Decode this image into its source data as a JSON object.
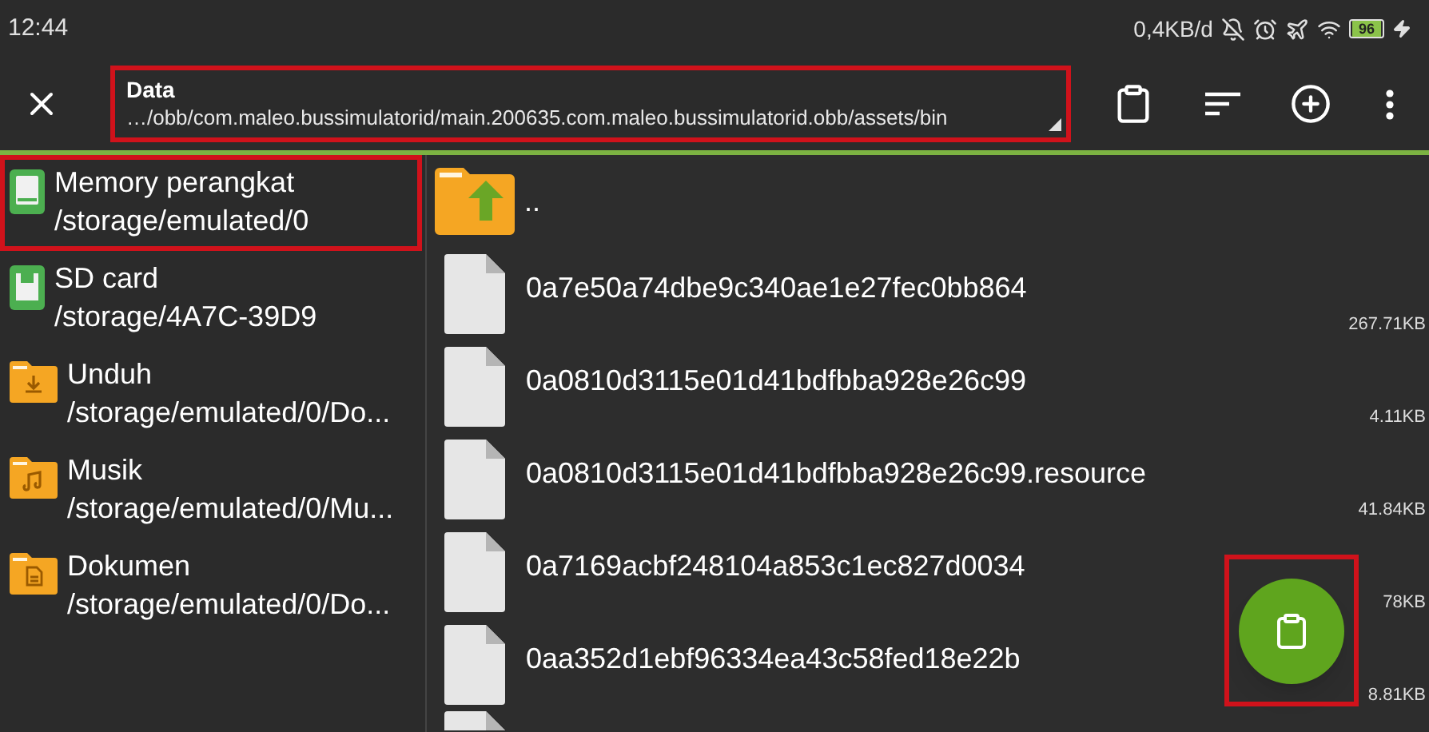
{
  "status_bar": {
    "time": "12:44",
    "speed": "0,4KB/d",
    "battery": "96"
  },
  "toolbar": {
    "title": "Data",
    "path": "…/obb/com.maleo.bussimulatorid/main.200635.com.maleo.bussimulatorid.obb/assets/bin",
    "highlighted": true
  },
  "sidebar": {
    "items": [
      {
        "kind": "device",
        "name": "Memory perangkat",
        "path": "/storage/emulated/0",
        "highlighted": true
      },
      {
        "kind": "sdcard",
        "name": "SD card",
        "path": "/storage/4A7C-39D9",
        "highlighted": false
      },
      {
        "kind": "download",
        "name": "Unduh",
        "path": "/storage/emulated/0/Do...",
        "highlighted": false
      },
      {
        "kind": "music",
        "name": "Musik",
        "path": "/storage/emulated/0/Mu...",
        "highlighted": false
      },
      {
        "kind": "document",
        "name": "Dokumen",
        "path": "/storage/emulated/0/Do...",
        "highlighted": false
      }
    ]
  },
  "files": {
    "parent": "..",
    "items": [
      {
        "name": "0a7e50a74dbe9c340ae1e27fec0bb864",
        "size": "267.71KB"
      },
      {
        "name": "0a0810d3115e01d41bdfbba928e26c99",
        "size": "4.11KB"
      },
      {
        "name": "0a0810d3115e01d41bdfbba928e26c99.resource",
        "size": "41.84KB"
      },
      {
        "name": "0a7169acbf248104a853c1ec827d0034",
        "size": "78KB"
      },
      {
        "name": "0aa352d1ebf96334ea43c58fed18e22b",
        "size": "8.81KB"
      }
    ]
  },
  "fab": {
    "highlighted": true
  }
}
